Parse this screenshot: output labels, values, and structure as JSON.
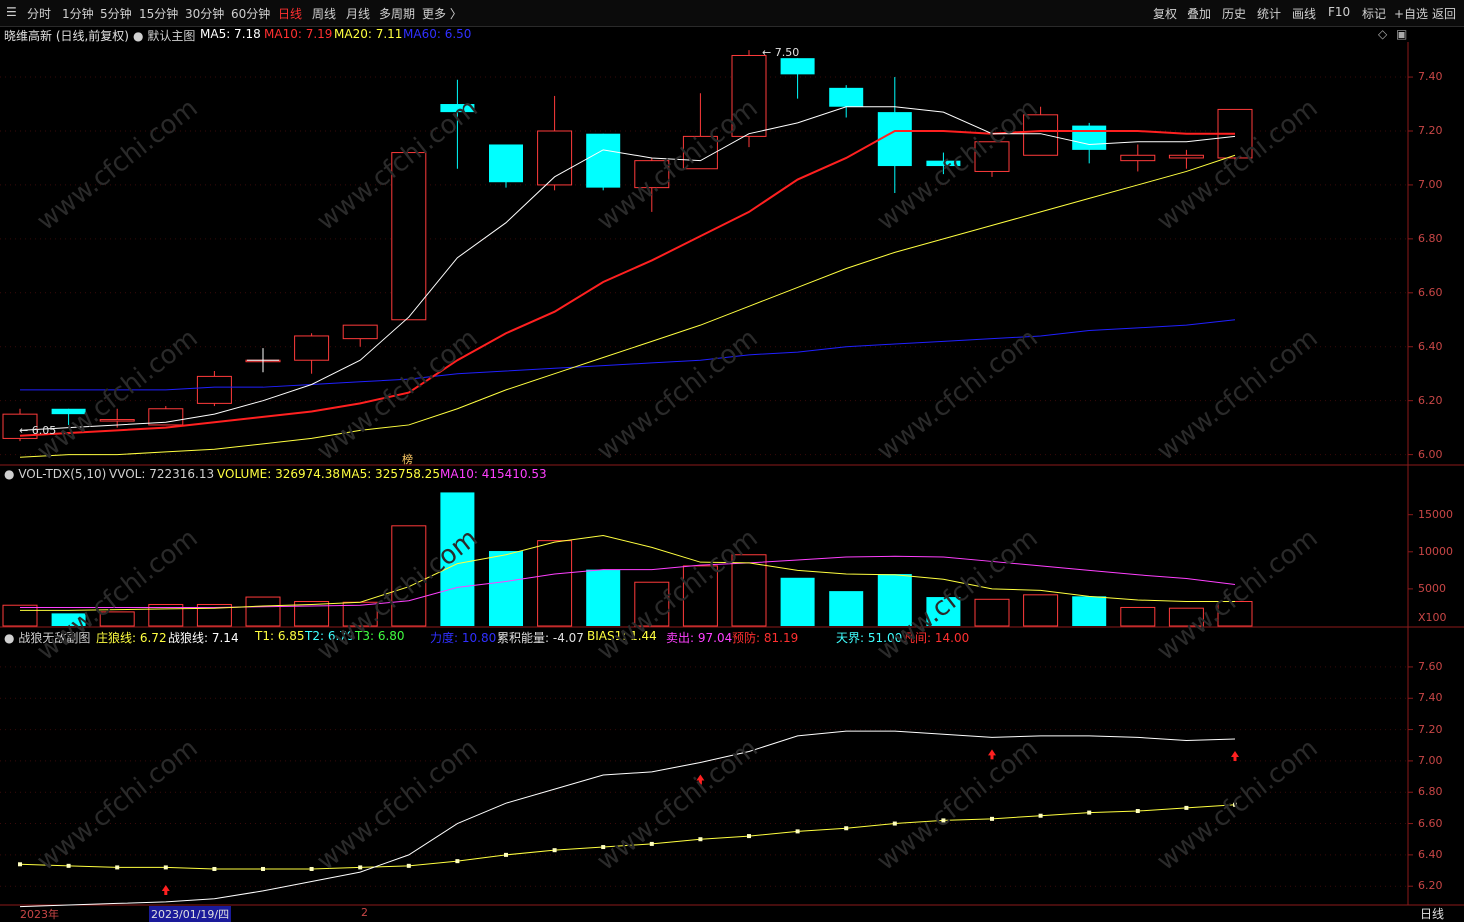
{
  "tabs": [
    {
      "label": "分时",
      "active": false
    },
    {
      "label": "1分钟",
      "active": false
    },
    {
      "label": "5分钟",
      "active": false
    },
    {
      "label": "15分钟",
      "active": false
    },
    {
      "label": "30分钟",
      "active": false
    },
    {
      "label": "60分钟",
      "active": false
    },
    {
      "label": "日线",
      "active": true
    },
    {
      "label": "周线",
      "active": false
    },
    {
      "label": "月线",
      "active": false
    },
    {
      "label": "多周期",
      "active": false
    },
    {
      "label": "更多 〉",
      "active": false
    }
  ],
  "right_buttons": [
    "复权",
    "叠加",
    "历史",
    "统计",
    "画线",
    "F10",
    "标记",
    "+自选",
    "返回"
  ],
  "main_header": {
    "stock": "晓维高新 (日线,前复权)",
    "template": "默认主图",
    "ma5": "MA5: 7.18",
    "ma10": "MA10: 7.19",
    "ma20": "MA20: 7.11",
    "ma60": "MA60: 6.50"
  },
  "vol_header": {
    "name": "VOL-TDX(5,10)",
    "vvol": "VVOL: 722316.13",
    "volume": "VOLUME: 326974.38",
    "ma5": "MA5: 325758.25",
    "ma10": "MA10: 415410.53"
  },
  "ind_header": {
    "name": "战狼无敌副图",
    "zhuang": "庄狼线: 6.72",
    "zhanlang": "战狼线: 7.14",
    "t1": "T1: 6.85",
    "t2": "T2: 6.79",
    "t3": "T3: 6.80",
    "lidu": "力度: 10.80",
    "leiji": "累积能量: -4.07",
    "bias": "BIAS1: 1.44",
    "maichu": "卖出: 97.04",
    "yujing": "预防: 81.19",
    "tianjie": "天界: 51.00",
    "fanjian": "凡间: 14.00"
  },
  "main_axis": [
    "7.40",
    "7.20",
    "7.00",
    "6.80",
    "6.60",
    "6.40",
    "6.20",
    "6.00"
  ],
  "vol_axis": [
    "15000",
    "10000",
    "5000",
    "X100"
  ],
  "ind_axis": [
    "7.60",
    "7.40",
    "7.20",
    "7.00",
    "6.80",
    "6.60",
    "6.40",
    "6.20"
  ],
  "annotations": {
    "high": "7.50",
    "low": "6.05",
    "bang": "榜"
  },
  "bottom": {
    "year": "2023年",
    "date": "2023/01/19/四",
    "mark": "2",
    "period": "日线"
  },
  "watermark": "www.cfchi.com",
  "colors": {
    "up": "#ff3b3b",
    "down": "#00ffff",
    "ma5": "#ffffff",
    "ma10": "#ff2020",
    "ma20": "#ffff40",
    "ma60": "#2020ff",
    "vol_ma10": "#ff40ff"
  },
  "chart_data": {
    "type": "candlestick",
    "title": "晓维高新 (日线,前复权)",
    "price_range": [
      5.98,
      7.53
    ],
    "candles": [
      {
        "o": 6.06,
        "h": 6.17,
        "l": 6.05,
        "c": 6.15
      },
      {
        "o": 6.17,
        "h": 6.17,
        "l": 6.11,
        "c": 6.15
      },
      {
        "o": 6.13,
        "h": 6.17,
        "l": 6.1,
        "c": 6.13
      },
      {
        "o": 6.11,
        "h": 6.18,
        "l": 6.11,
        "c": 6.17
      },
      {
        "o": 6.19,
        "h": 6.31,
        "l": 6.18,
        "c": 6.29
      },
      {
        "o": 6.35,
        "h": 6.38,
        "l": 6.32,
        "c": 6.35
      },
      {
        "o": 6.35,
        "h": 6.45,
        "l": 6.3,
        "c": 6.44
      },
      {
        "o": 6.43,
        "h": 6.48,
        "l": 6.4,
        "c": 6.48
      },
      {
        "o": 6.5,
        "h": 7.12,
        "l": 6.5,
        "c": 7.12
      },
      {
        "o": 7.3,
        "h": 7.39,
        "l": 7.06,
        "c": 7.27
      },
      {
        "o": 7.15,
        "h": 7.15,
        "l": 6.99,
        "c": 7.01
      },
      {
        "o": 7.0,
        "h": 7.33,
        "l": 6.98,
        "c": 7.2
      },
      {
        "o": 7.19,
        "h": 7.19,
        "l": 6.98,
        "c": 6.99
      },
      {
        "o": 6.99,
        "h": 7.1,
        "l": 6.9,
        "c": 7.09
      },
      {
        "o": 7.06,
        "h": 7.34,
        "l": 7.06,
        "c": 7.18
      },
      {
        "o": 7.18,
        "h": 7.5,
        "l": 7.14,
        "c": 7.48
      },
      {
        "o": 7.47,
        "h": 7.47,
        "l": 7.32,
        "c": 7.41
      },
      {
        "o": 7.36,
        "h": 7.37,
        "l": 7.25,
        "c": 7.29
      },
      {
        "o": 7.27,
        "h": 7.4,
        "l": 6.97,
        "c": 7.07
      },
      {
        "o": 7.09,
        "h": 7.12,
        "l": 7.04,
        "c": 7.07
      },
      {
        "o": 7.05,
        "h": 7.16,
        "l": 7.03,
        "c": 7.16
      },
      {
        "o": 7.11,
        "h": 7.29,
        "l": 7.11,
        "c": 7.26
      },
      {
        "o": 7.22,
        "h": 7.23,
        "l": 7.08,
        "c": 7.13
      },
      {
        "o": 7.09,
        "h": 7.15,
        "l": 7.05,
        "c": 7.11
      },
      {
        "o": 7.1,
        "h": 7.13,
        "l": 7.06,
        "c": 7.11
      },
      {
        "o": 7.1,
        "h": 7.28,
        "l": 7.07,
        "c": 7.28
      }
    ],
    "ma5": [
      6.09,
      6.1,
      6.11,
      6.12,
      6.15,
      6.2,
      6.26,
      6.35,
      6.51,
      6.73,
      6.86,
      7.03,
      7.13,
      7.1,
      7.09,
      7.19,
      7.23,
      7.29,
      7.29,
      7.27,
      7.19,
      7.19,
      7.15,
      7.16,
      7.16,
      7.18
    ],
    "ma10": [
      6.07,
      6.08,
      6.09,
      6.1,
      6.12,
      6.14,
      6.16,
      6.19,
      6.23,
      6.35,
      6.45,
      6.53,
      6.64,
      6.72,
      6.81,
      6.9,
      7.02,
      7.1,
      7.2,
      7.2,
      7.19,
      7.2,
      7.2,
      7.2,
      7.19,
      7.19
    ],
    "ma20": [
      5.99,
      6.0,
      6.0,
      6.01,
      6.02,
      6.04,
      6.06,
      6.09,
      6.11,
      6.17,
      6.24,
      6.3,
      6.36,
      6.42,
      6.48,
      6.55,
      6.62,
      6.69,
      6.75,
      6.8,
      6.85,
      6.9,
      6.95,
      7.0,
      7.05,
      7.11
    ],
    "ma60": [
      6.24,
      6.24,
      6.24,
      6.24,
      6.25,
      6.25,
      6.26,
      6.27,
      6.28,
      6.3,
      6.31,
      6.32,
      6.33,
      6.34,
      6.35,
      6.37,
      6.38,
      6.4,
      6.41,
      6.42,
      6.43,
      6.44,
      6.46,
      6.47,
      6.48,
      6.5
    ],
    "volume": [
      2800,
      1700,
      1900,
      2900,
      2900,
      3900,
      3300,
      3200,
      13500,
      18000,
      10100,
      11500,
      7600,
      5900,
      8100,
      9600,
      6500,
      4700,
      7000,
      3900,
      3600,
      4200,
      4000,
      2500,
      2400,
      3300
    ],
    "vol_ma5": [
      2100,
      2100,
      2200,
      2300,
      2400,
      2700,
      2900,
      3200,
      5300,
      8400,
      9600,
      11300,
      12200,
      10600,
      8600,
      8500,
      7500,
      7000,
      6900,
      6300,
      5000,
      4800,
      4000,
      3500,
      3300,
      3300
    ],
    "vol_ma10": [
      2500,
      2500,
      2500,
      2500,
      2500,
      2600,
      2700,
      2800,
      3400,
      5200,
      6000,
      7000,
      7600,
      7600,
      8200,
      8500,
      8900,
      9300,
      9400,
      9300,
      8700,
      8100,
      7500,
      6900,
      6400,
      5600
    ],
    "zhanlang": [
      6.07,
      6.08,
      6.09,
      6.1,
      6.12,
      6.17,
      6.23,
      6.29,
      6.4,
      6.6,
      6.73,
      6.82,
      6.91,
      6.93,
      6.99,
      7.06,
      7.16,
      7.19,
      7.19,
      7.17,
      7.15,
      7.16,
      7.16,
      7.15,
      7.13,
      7.14
    ],
    "zhuanglang": [
      6.34,
      6.33,
      6.32,
      6.32,
      6.31,
      6.31,
      6.31,
      6.32,
      6.33,
      6.36,
      6.4,
      6.43,
      6.45,
      6.47,
      6.5,
      6.52,
      6.55,
      6.57,
      6.6,
      6.62,
      6.63,
      6.65,
      6.67,
      6.68,
      6.7,
      6.72
    ],
    "arrows_red_up": [
      3,
      14,
      20,
      25
    ]
  }
}
